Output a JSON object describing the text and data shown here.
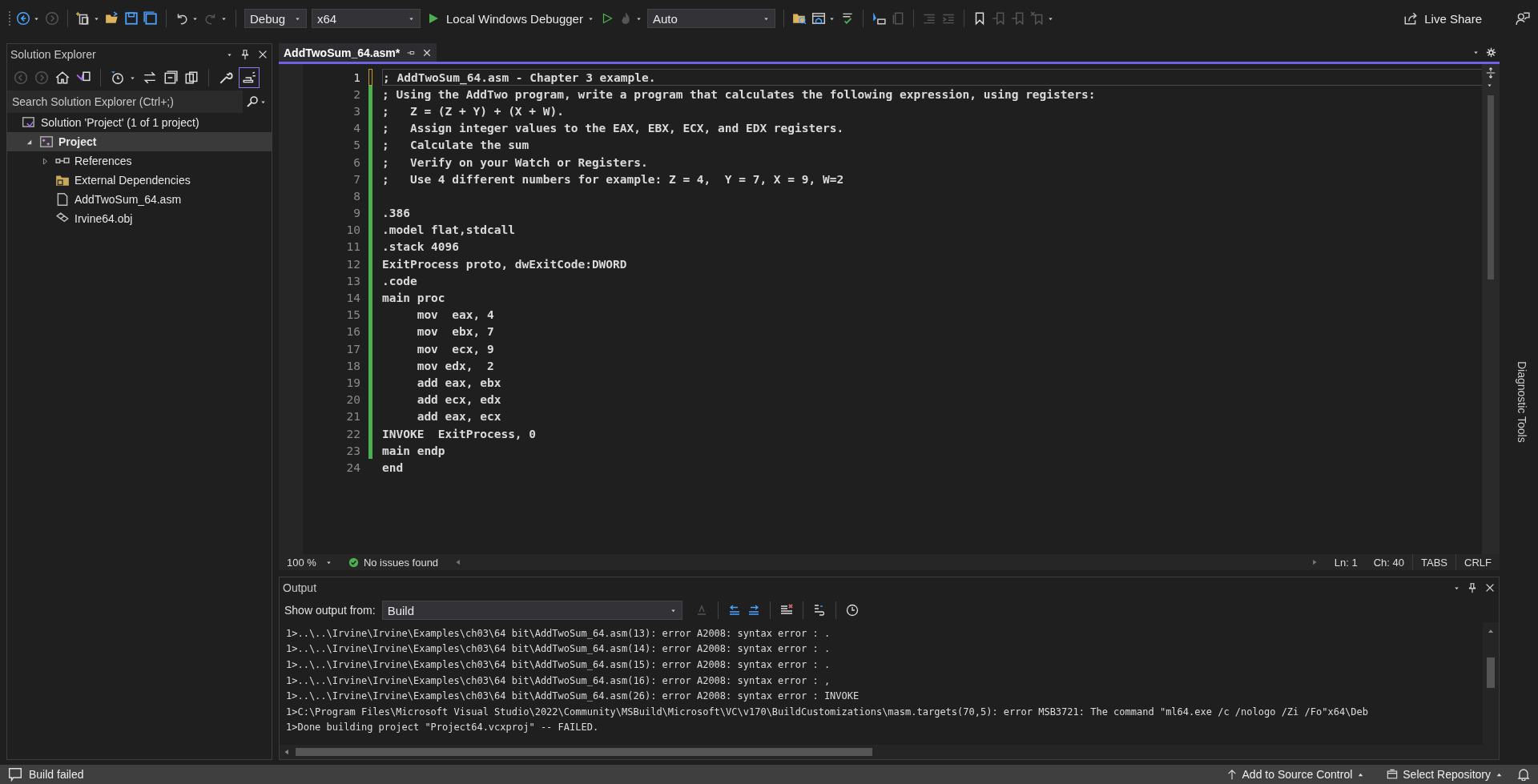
{
  "toolbar": {
    "configuration": "Debug",
    "platform": "x64",
    "debugger": "Local Windows Debugger",
    "mode": "Auto",
    "live_share": "Live Share"
  },
  "solution_explorer": {
    "title": "Solution Explorer",
    "search": {
      "placeholder": "Search Solution Explorer (Ctrl+;)"
    },
    "tree": [
      {
        "label": "Solution 'Project' (1 of 1 project)",
        "kind": "solution",
        "selected": false
      },
      {
        "label": "Project",
        "kind": "project",
        "selected": true,
        "expanded": true,
        "children": [
          {
            "label": "References",
            "kind": "references",
            "selected": false,
            "expanded": false
          },
          {
            "label": "External Dependencies",
            "kind": "folder",
            "selected": false
          },
          {
            "label": "AddTwoSum_64.asm",
            "kind": "file",
            "selected": false
          },
          {
            "label": "Irvine64.obj",
            "kind": "object",
            "selected": false
          }
        ]
      }
    ]
  },
  "editor": {
    "tabs": [
      {
        "label": "AddTwoSum_64.asm*",
        "selected": true
      }
    ],
    "lines": [
      {
        "number": "1",
        "text": "; AddTwoSum_64.asm - Chapter 3 example.",
        "changed": true,
        "unsaved": true,
        "current": true
      },
      {
        "number": "2",
        "text": "; Using the AddTwo program, write a program that calculates the following expression, using registers:",
        "changed": true,
        "unsaved": false,
        "current": false
      },
      {
        "number": "3",
        "text": ";   Z = (Z + Y) + (X + W).",
        "changed": true,
        "unsaved": false,
        "current": false
      },
      {
        "number": "4",
        "text": ";   Assign integer values to the EAX, EBX, ECX, and EDX registers.",
        "changed": true,
        "unsaved": false,
        "current": false
      },
      {
        "number": "5",
        "text": ";   Calculate the sum",
        "changed": true,
        "unsaved": false,
        "current": false
      },
      {
        "number": "6",
        "text": ";   Verify on your Watch or Registers.",
        "changed": true,
        "unsaved": false,
        "current": false
      },
      {
        "number": "7",
        "text": ";   Use 4 different numbers for example: Z = 4,  Y = 7, X = 9, W=2",
        "changed": true,
        "unsaved": false,
        "current": false
      },
      {
        "number": "8",
        "changed": true,
        "unsaved": false,
        "current": false
      },
      {
        "number": "9",
        "text": ".386",
        "changed": true,
        "unsaved": false,
        "current": false
      },
      {
        "number": "10",
        "text": ".model flat,stdcall",
        "changed": true,
        "unsaved": false,
        "current": false
      },
      {
        "number": "11",
        "text": ".stack 4096",
        "changed": true,
        "unsaved": false,
        "current": false
      },
      {
        "number": "12",
        "text": "ExitProcess proto, dwExitCode:DWORD",
        "changed": true,
        "unsaved": false,
        "current": false
      },
      {
        "number": "13",
        "text": ".code",
        "changed": true,
        "unsaved": false,
        "current": false
      },
      {
        "number": "14",
        "text": "main proc",
        "changed": true,
        "unsaved": false,
        "current": false
      },
      {
        "number": "15",
        "text": "     mov  eax, 4",
        "changed": true,
        "unsaved": false,
        "current": false
      },
      {
        "number": "16",
        "text": "     mov  ebx, 7",
        "changed": true,
        "unsaved": false,
        "current": false
      },
      {
        "number": "17",
        "text": "     mov  ecx, 9",
        "changed": true,
        "unsaved": false,
        "current": false
      },
      {
        "number": "18",
        "text": "     mov edx,  2",
        "changed": true,
        "unsaved": false,
        "current": false
      },
      {
        "number": "19",
        "text": "     add eax, ebx",
        "changed": true,
        "unsaved": false,
        "current": false
      },
      {
        "number": "20",
        "text": "     add ecx, edx",
        "changed": true,
        "unsaved": false,
        "current": false
      },
      {
        "number": "21",
        "text": "     add eax, ecx",
        "changed": true,
        "unsaved": false,
        "current": false
      },
      {
        "number": "22",
        "text": "INVOKE  ExitProcess, 0",
        "changed": true,
        "unsaved": false,
        "current": false
      },
      {
        "number": "23",
        "text": "main endp",
        "changed": true,
        "unsaved": false,
        "current": false
      },
      {
        "number": "24",
        "text": "end",
        "changed": false,
        "current": false
      }
    ],
    "status": {
      "zoom": "100 %",
      "issues": "No issues found",
      "line": "Ln: 1",
      "column": "Ch: 40",
      "indent": "TABS",
      "line_endings": "CRLF"
    }
  },
  "output": {
    "title": "Output",
    "source_label": "Show output from:",
    "source": "Build",
    "lines": [
      "1>..\\..\\Irvine\\Irvine\\Examples\\ch03\\64 bit\\AddTwoSum_64.asm(13): error A2008: syntax error : .",
      "1>..\\..\\Irvine\\Irvine\\Examples\\ch03\\64 bit\\AddTwoSum_64.asm(14): error A2008: syntax error : .",
      "1>..\\..\\Irvine\\Irvine\\Examples\\ch03\\64 bit\\AddTwoSum_64.asm(15): error A2008: syntax error : .",
      "1>..\\..\\Irvine\\Irvine\\Examples\\ch03\\64 bit\\AddTwoSum_64.asm(16): error A2008: syntax error : ,",
      "1>..\\..\\Irvine\\Irvine\\Examples\\ch03\\64 bit\\AddTwoSum_64.asm(26): error A2008: syntax error : INVOKE",
      "1>C:\\Program Files\\Microsoft Visual Studio\\2022\\Community\\MSBuild\\Microsoft\\VC\\v170\\BuildCustomizations\\masm.targets(70,5): error MSB3721: The command \"ml64.exe /c /nologo /Zi /Fo\"x64\\Deb",
      "1>Done building project \"Project64.vcxproj\" -- FAILED."
    ]
  },
  "side_rail": {
    "label": "Diagnostic Tools"
  },
  "status_bar": {
    "message": "Build failed",
    "source_control": "Add to Source Control",
    "repository": "Select Repository"
  }
}
